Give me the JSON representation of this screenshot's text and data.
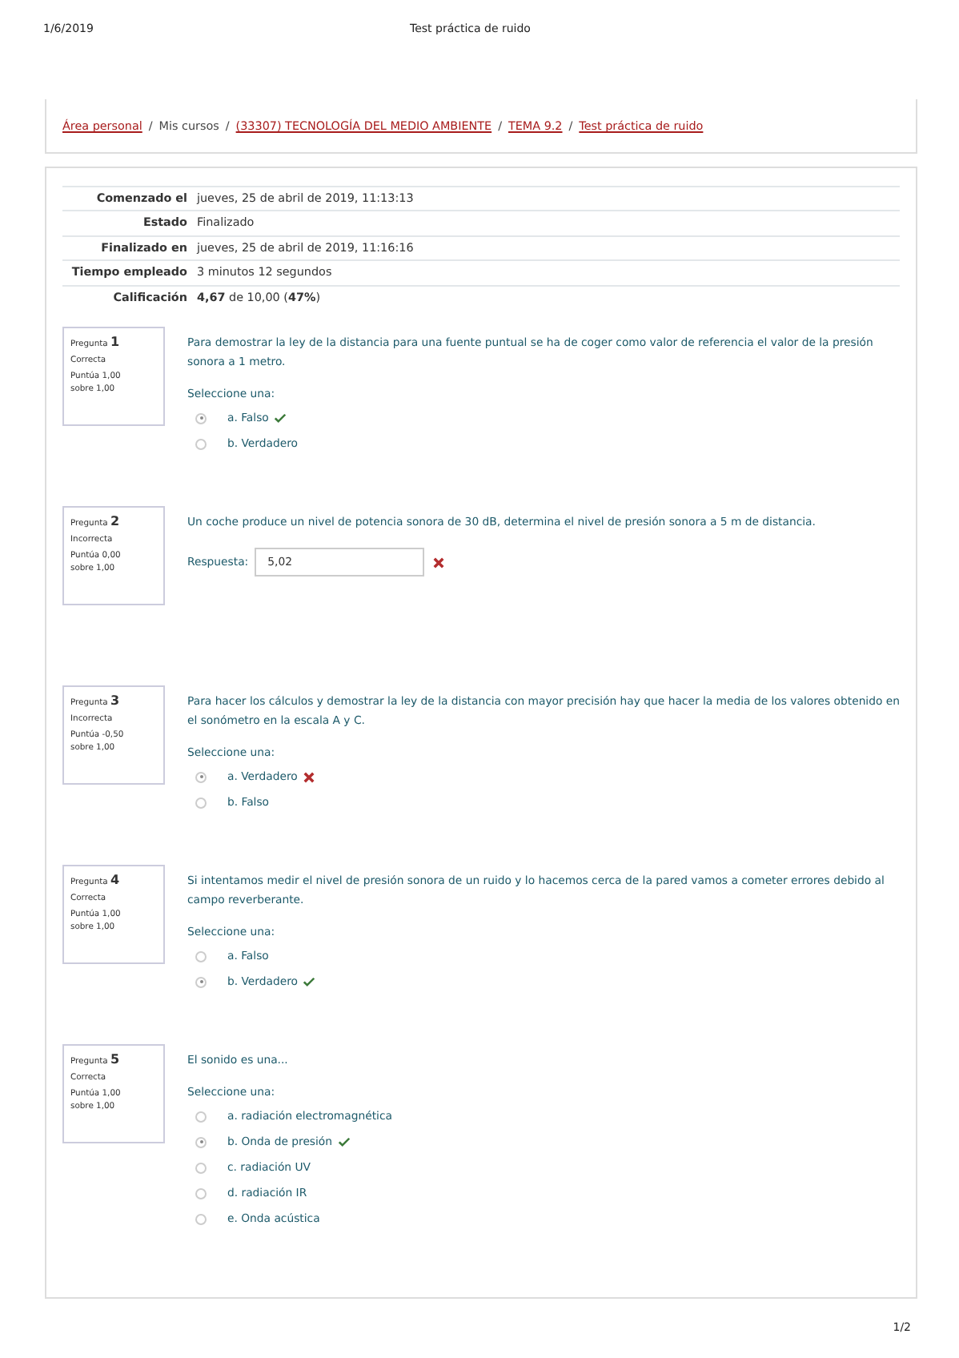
{
  "print_header": {
    "date": "1/6/2019",
    "title": "Test práctica de ruido"
  },
  "breadcrumb_separator": "/",
  "breadcrumb": [
    {
      "label": "Área personal",
      "link": true
    },
    {
      "label": "Mis cursos",
      "link": false
    },
    {
      "label": "(33307) TECNOLOGÍA DEL MEDIO AMBIENTE",
      "link": true
    },
    {
      "label": "TEMA 9.2",
      "link": true
    },
    {
      "label": "Test práctica de ruido",
      "link": true
    }
  ],
  "summary": [
    {
      "label": "Comenzado el",
      "value": "jueves, 25 de abril de 2019, 11:13:13"
    },
    {
      "label": "Estado",
      "value": "Finalizado"
    },
    {
      "label": "Finalizado en",
      "value": "jueves, 25 de abril de 2019, 11:16:16"
    },
    {
      "label": "Tiempo empleado",
      "value": "3 minutos 12 segundos"
    },
    {
      "label": "Calificación",
      "value": "**4,67** de 10,00 (**47%**)"
    }
  ],
  "questions": [
    {
      "label": "Pregunta",
      "number": "1",
      "state": "Correcta",
      "grade": "Puntúa 1,00 sobre 1,00",
      "text": "Para demostrar la ley de la distancia para una fuente puntual se ha de coger como valor de referencia el valor de la presión sonora a 1 metro.",
      "kind": "choice",
      "prompt": "Seleccione una:",
      "options": [
        {
          "label": "a. Falso",
          "selected": true,
          "correct": true
        },
        {
          "label": "b. Verdadero",
          "selected": false
        }
      ]
    },
    {
      "label": "Pregunta",
      "number": "2",
      "state": "Incorrecta",
      "grade": "Puntúa 0,00 sobre 1,00",
      "text": "Un coche produce un nivel de potencia sonora de 30 dB, determina el nivel de presión sonora a 5 m de distancia.",
      "kind": "short_answer",
      "prompt": "Respuesta:",
      "answer": "5,02",
      "correct": false
    },
    {
      "label": "Pregunta",
      "number": "3",
      "state": "Incorrecta",
      "grade": "Puntúa -0,50 sobre 1,00",
      "text": "Para hacer los cálculos y demostrar la ley de la distancia con mayor precisión hay que hacer la media de los valores obtenido en el sonómetro en la escala A y C.",
      "kind": "choice",
      "prompt": "Seleccione una:",
      "options": [
        {
          "label": "a. Verdadero",
          "selected": true,
          "correct": false
        },
        {
          "label": "b. Falso",
          "selected": false
        }
      ]
    },
    {
      "label": "Pregunta",
      "number": "4",
      "state": "Correcta",
      "grade": "Puntúa 1,00 sobre 1,00",
      "text": "Si intentamos medir el nivel de presión sonora de un ruido y lo hacemos cerca de la pared vamos a cometer errores debido al campo reverberante.",
      "kind": "choice",
      "prompt": "Seleccione una:",
      "options": [
        {
          "label": "a. Falso",
          "selected": false
        },
        {
          "label": "b. Verdadero",
          "selected": true,
          "correct": true
        }
      ]
    },
    {
      "label": "Pregunta",
      "number": "5",
      "state": "Correcta",
      "grade": "Puntúa 1,00 sobre 1,00",
      "text": "El sonido es una...",
      "kind": "choice",
      "prompt": "Seleccione una:",
      "options": [
        {
          "label": "a. radiación electromagnética",
          "selected": false
        },
        {
          "label": "b. Onda de presión",
          "selected": true,
          "correct": true
        },
        {
          "label": "c. radiación UV",
          "selected": false
        },
        {
          "label": "d. radiación IR",
          "selected": false
        },
        {
          "label": "e. Onda acústica",
          "selected": false
        }
      ]
    }
  ],
  "print_footer": {
    "page": "1/2"
  }
}
